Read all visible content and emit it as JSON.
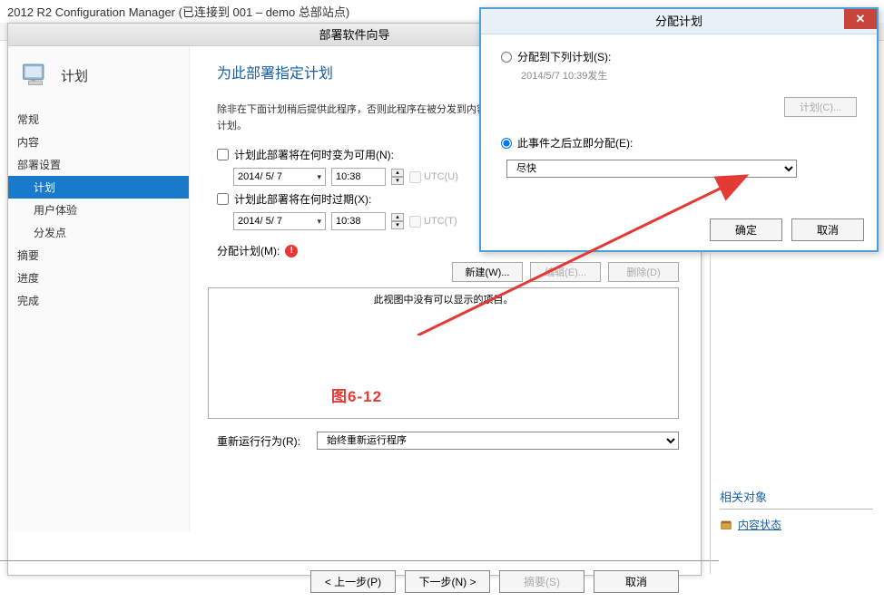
{
  "window": {
    "title": "2012 R2 Configuration Manager (已连接到 001 – demo 总部站点)"
  },
  "toolbar_icon": "➔",
  "wizard": {
    "title": "部署软件向导",
    "sidebar_label": "计划",
    "nav": {
      "general": "常规",
      "content": "内容",
      "deploy_settings": "部署设置",
      "schedule": "计划",
      "user_experience": "用户体验",
      "distribution_points": "分发点",
      "summary": "摘要",
      "progress": "进度",
      "complete": "完成"
    },
    "content": {
      "title": "为此部署指定计划",
      "hint": "除非在下面计划稍后提供此程序，否则此程序在被分发到内容分配计划。",
      "chk_available_label": "计划此部署将在何时变为可用(N):",
      "chk_expire_label": "计划此部署将在何时过期(X):",
      "date_value": "2014/ 5/ 7",
      "time_value": "10:38",
      "utc_u": "UTC(U)",
      "utc_t": "UTC(T)",
      "assign_label": "分配计划(M):",
      "btn_new": "新建(W)...",
      "btn_edit": "编辑(E)...",
      "btn_delete": "删除(D)",
      "empty_list": "此视图中没有可以显示的项目。",
      "rerun_label": "重新运行行为(R):",
      "rerun_value": "始终重新运行程序"
    },
    "footer": {
      "prev": "< 上一步(P)",
      "next": "下一步(N) >",
      "summary": "摘要(S)",
      "cancel": "取消"
    }
  },
  "modal": {
    "title": "分配计划",
    "radio1_label": "分配到下列计划(S):",
    "radio1_value": "2014/5/7 10:39发生",
    "btn_plan": "计划(C)...",
    "radio2_label": "此事件之后立即分配(E):",
    "select_value": "尽快",
    "btn_ok": "确定",
    "btn_cancel": "取消"
  },
  "figure_label": "图6-12",
  "right_panel": {
    "title": "相关对象",
    "link": "内容状态"
  }
}
